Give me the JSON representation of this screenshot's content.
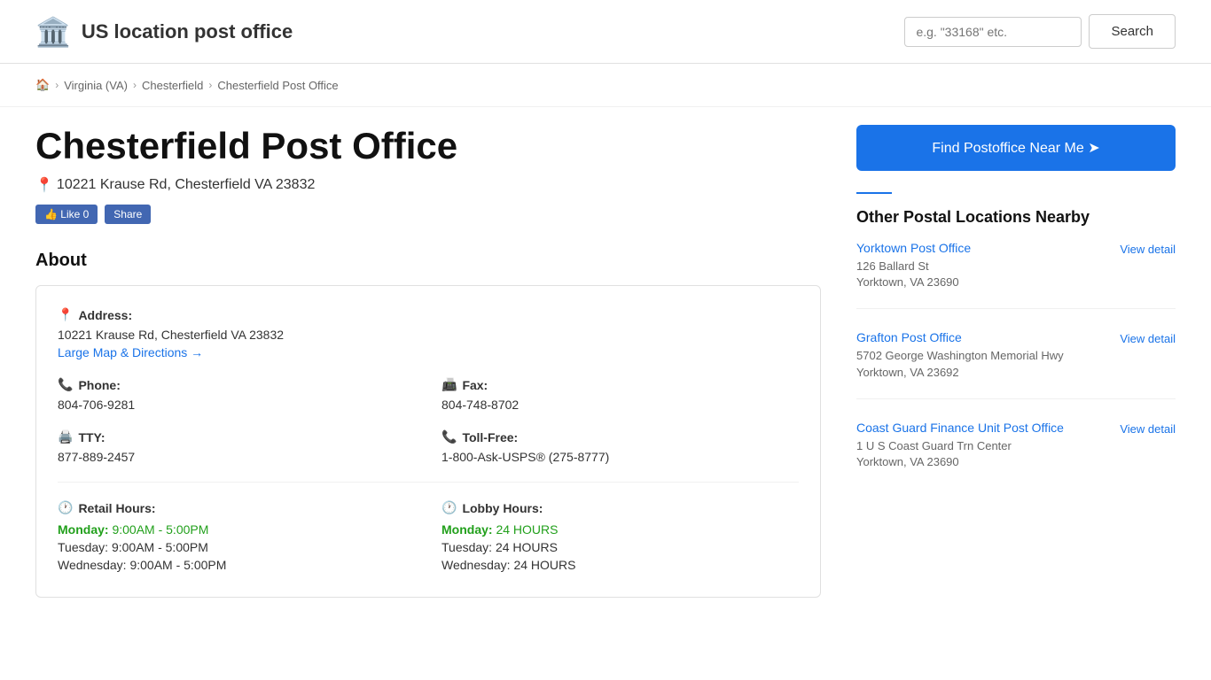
{
  "header": {
    "logo": "🏛️",
    "title": "US location post office",
    "search_placeholder": "e.g. \"33168\" etc.",
    "search_label": "Search"
  },
  "breadcrumb": {
    "home": "🏠",
    "items": [
      "Virginia (VA)",
      "Chesterfield",
      "Chesterfield Post Office"
    ]
  },
  "page": {
    "title": "Chesterfield Post Office",
    "address": "10221 Krause Rd, Chesterfield VA 23832",
    "about_heading": "About"
  },
  "facebook": {
    "like_label": "👍 Like 0",
    "share_label": "Share"
  },
  "info": {
    "address_label": "Address:",
    "address_value": "10221 Krause Rd, Chesterfield VA 23832",
    "map_link": "Large Map & Directions →",
    "phone_label": "Phone:",
    "phone_value": "804-706-9281",
    "fax_label": "Fax:",
    "fax_value": "804-748-8702",
    "tty_label": "TTY:",
    "tty_value": "877-889-2457",
    "tollfree_label": "Toll-Free:",
    "tollfree_value": "1-800-Ask-USPS® (275-8777)"
  },
  "retail_hours": {
    "label": "Retail Hours:",
    "monday_day": "Monday:",
    "monday_time": "9:00AM - 5:00PM",
    "tuesday": "Tuesday: 9:00AM - 5:00PM",
    "wednesday": "Wednesday: 9:00AM - 5:00PM"
  },
  "lobby_hours": {
    "label": "Lobby Hours:",
    "monday_day": "Monday:",
    "monday_time": "24 HOURS",
    "tuesday": "Tuesday: 24 HOURS",
    "wednesday": "Wednesday: 24 HOURS"
  },
  "sidebar": {
    "find_btn_label": "Find Postoffice Near Me ➤",
    "nearby_heading": "Other Postal Locations Nearby",
    "nearby": [
      {
        "name": "Yorktown Post Office",
        "address": "126 Ballard St\nYorktown, VA 23690",
        "view_label": "View detail"
      },
      {
        "name": "Grafton Post Office",
        "address": "5702 George Washington Memorial Hwy\nYorktown, VA 23692",
        "view_label": "View detail"
      },
      {
        "name": "Coast Guard Finance Unit Post Office",
        "address": "1 U S Coast Guard Trn Center\nYorktown, VA 23690",
        "view_label": "View detail"
      }
    ]
  }
}
